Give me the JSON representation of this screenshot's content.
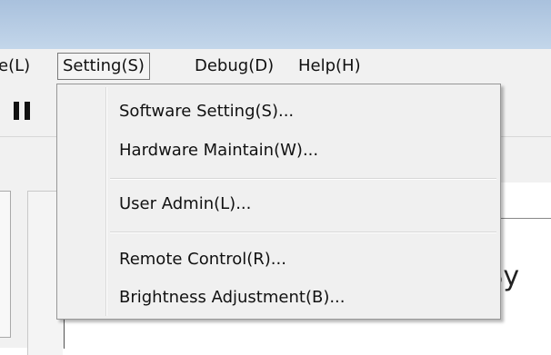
{
  "menubar": {
    "items": [
      {
        "label": "e(L)"
      },
      {
        "label": "Setting(S)"
      },
      {
        "label": "Debug(D)"
      },
      {
        "label": "Help(H)"
      }
    ]
  },
  "toolbar": {
    "pause_icon": "pause-icon"
  },
  "dropdown": {
    "items": [
      {
        "label": "Software Setting(S)..."
      },
      {
        "label": "Hardware Maintain(W)..."
      },
      {
        "label": "User Admin(L)..."
      },
      {
        "label": "Remote Control(R)..."
      },
      {
        "label": "Brightness Adjustment(B)..."
      }
    ]
  },
  "content": {
    "visible_text": "t Sy"
  }
}
